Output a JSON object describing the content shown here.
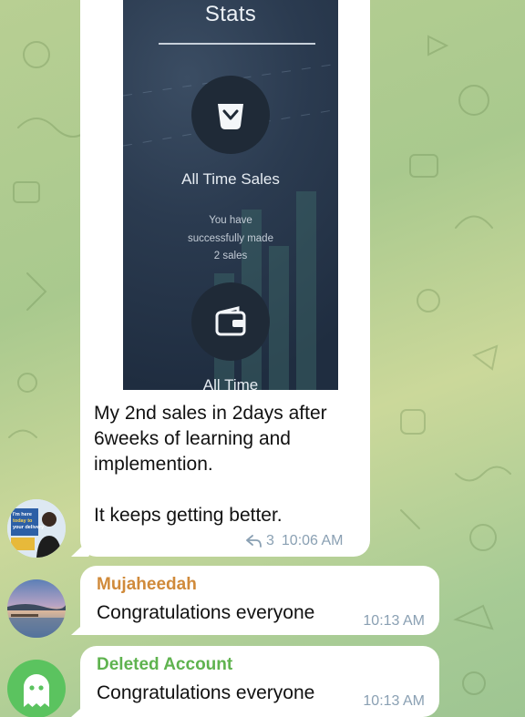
{
  "colors": {
    "background": "#b8cf93",
    "bubble": "#ffffff",
    "meta_text": "#8aa0b3",
    "sender_mujaheedah": "#d08a3a",
    "sender_deleted": "#5fb34f"
  },
  "messages": [
    {
      "type": "photo",
      "photo": {
        "title": "Stats",
        "stat1_icon": "bag-icon",
        "stat1_label": "All Time Sales",
        "stat1_sub_line1": "You have",
        "stat1_sub_line2": "successfully made",
        "stat1_sub_line3": "2 sales",
        "stat2_icon": "wallet-icon",
        "stat2_label": "All Time"
      },
      "caption_line1": "My 2nd sales in 2days after 6weeks of learning and implemention.",
      "caption_line2": "It keeps getting better.",
      "reply_icon": "forward-icon",
      "reply_count": "3",
      "time": "10:06 AM",
      "avatar_lines": [
        "I'm here",
        "today to",
        "your delivery"
      ]
    },
    {
      "type": "text",
      "sender": "Mujaheedah",
      "text": "Congratulations everyone",
      "time": "10:13 AM"
    },
    {
      "type": "text",
      "sender": "Deleted Account",
      "text": "Congratulations everyone",
      "time": "10:13 AM",
      "avatar_icon": "ghost-icon"
    }
  ]
}
